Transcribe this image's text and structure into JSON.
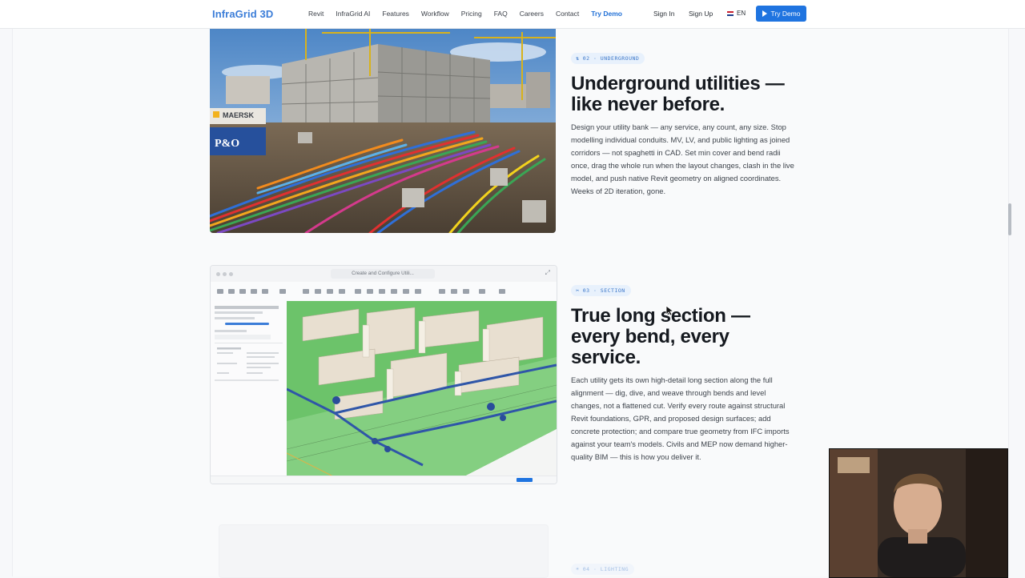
{
  "nav": {
    "logo": "InfraGrid 3D",
    "links": [
      "Revit",
      "InfraGrid AI",
      "Features",
      "Workflow",
      "Pricing",
      "FAQ",
      "Careers",
      "Contact",
      "Try Demo"
    ],
    "sign_in": "Sign In",
    "sign_up": "Sign Up",
    "language": "EN",
    "cta": "Try Demo"
  },
  "sections": [
    {
      "tag": "02 · UNDERGROUND",
      "tag_icon": "pipes-icon",
      "title_line1": "Underground utilities —",
      "title_line2": "like never before.",
      "body": "Design your utility bank — any service, any count, any size. Stop modelling individual conduits. MV, LV, and public lighting as joined corridors — not spaghetti in CAD. Set min cover and bend radii once, drag the whole run when the layout changes, clash in the live model, and push native Revit geometry on aligned coordinates. Weeks of 2D iteration, gone.",
      "photo_labels": [
        "MAERSK",
        "P&O"
      ]
    },
    {
      "tag": "03 · SECTION",
      "tag_icon": "scissors-icon",
      "title_line1": "True long section —",
      "title_line2": "every bend, every",
      "title_line3": "service.",
      "body": "Each utility gets its own high-detail long section along the full alignment — dig, dive, and weave through bends and level changes, not a flattened cut. Verify every route against structural Revit foundations, GPR, and proposed design surfaces; add concrete protection; and compare true geometry from IFC imports against your team's models. Civils and MEP now demand higher-quality BIM — this is how you deliver it.",
      "app_window_title": "Create and Configure Utili..."
    },
    {
      "tag": "04 · LIGHTING",
      "tag_icon": "bulb-icon"
    }
  ],
  "colors": {
    "accent": "#1f74e0",
    "logo": "#3b7dd8",
    "tag_bg": "#e8f1fc",
    "heading": "#15191f"
  }
}
